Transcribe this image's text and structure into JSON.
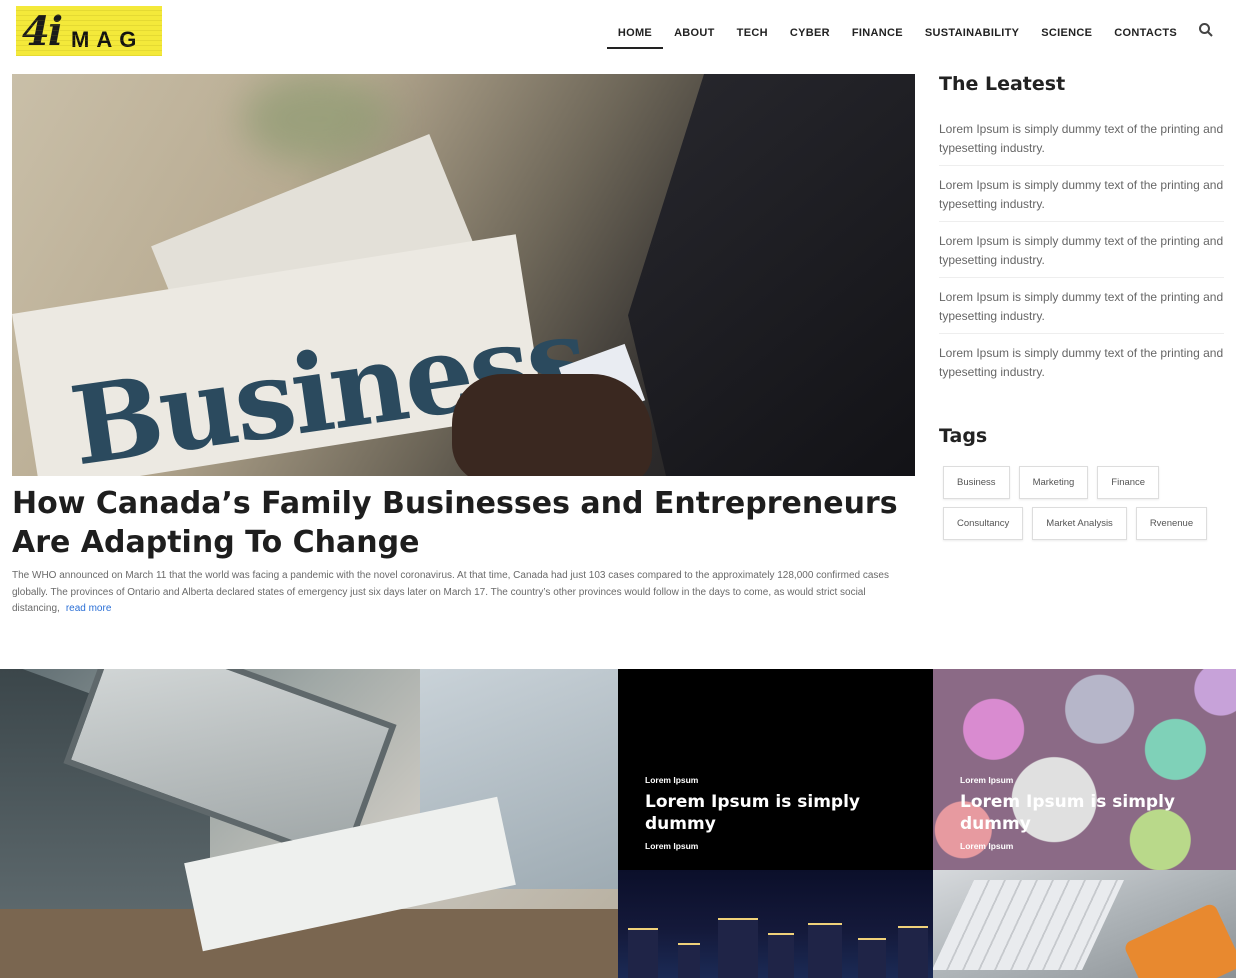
{
  "site": {
    "logo_number": "4i",
    "logo_text": "MAG"
  },
  "nav": {
    "items": [
      {
        "label": "HOME",
        "active": true
      },
      {
        "label": "ABOUT"
      },
      {
        "label": "TECH"
      },
      {
        "label": "CYBER"
      },
      {
        "label": "FINANCE"
      },
      {
        "label": "SUSTAINABILITY"
      },
      {
        "label": "SCIENCE"
      },
      {
        "label": "CONTACTS"
      }
    ],
    "search_icon": "search-icon"
  },
  "hero": {
    "image_word": "Business",
    "title": "How Canada’s Family Businesses and Entrepreneurs Are Adapting To Change",
    "excerpt": "The WHO announced on March 11 that the world was facing a pandemic with the novel coronavirus. At that time, Canada had just 103 cases compared to the approximately 128,000 confirmed cases globally. The provinces of Ontario and Alberta declared states of emergency just six days later on March 17. The country’s other provinces would follow in the days to come, as would strict social distancing,",
    "read_more": "read more"
  },
  "sidebar": {
    "latest_title": "The Leatest",
    "latest": [
      "Lorem Ipsum is simply dummy text of the printing and typesetting industry.",
      "Lorem Ipsum is simply dummy text of the printing and typesetting industry.",
      "Lorem Ipsum is simply dummy text of the printing and typesetting industry.",
      "Lorem Ipsum is simply dummy text of the printing and typesetting industry.",
      "Lorem Ipsum is simply dummy text of the printing and typesetting industry."
    ],
    "tags_title": "Tags",
    "tags": [
      "Business",
      "Marketing",
      "Finance",
      "Consultancy",
      "Market Analysis",
      "Rvenenue"
    ]
  },
  "cards": [
    {
      "category": "Lorem Ipsum",
      "title": "Lorem Ipsum is simply dummy",
      "subtitle": "Lorem Ipsum"
    },
    {
      "category": "Lorem Ipsum",
      "title": "Lorem Ipsum is simply dummy",
      "subtitle": "Lorem Ipsum"
    }
  ]
}
